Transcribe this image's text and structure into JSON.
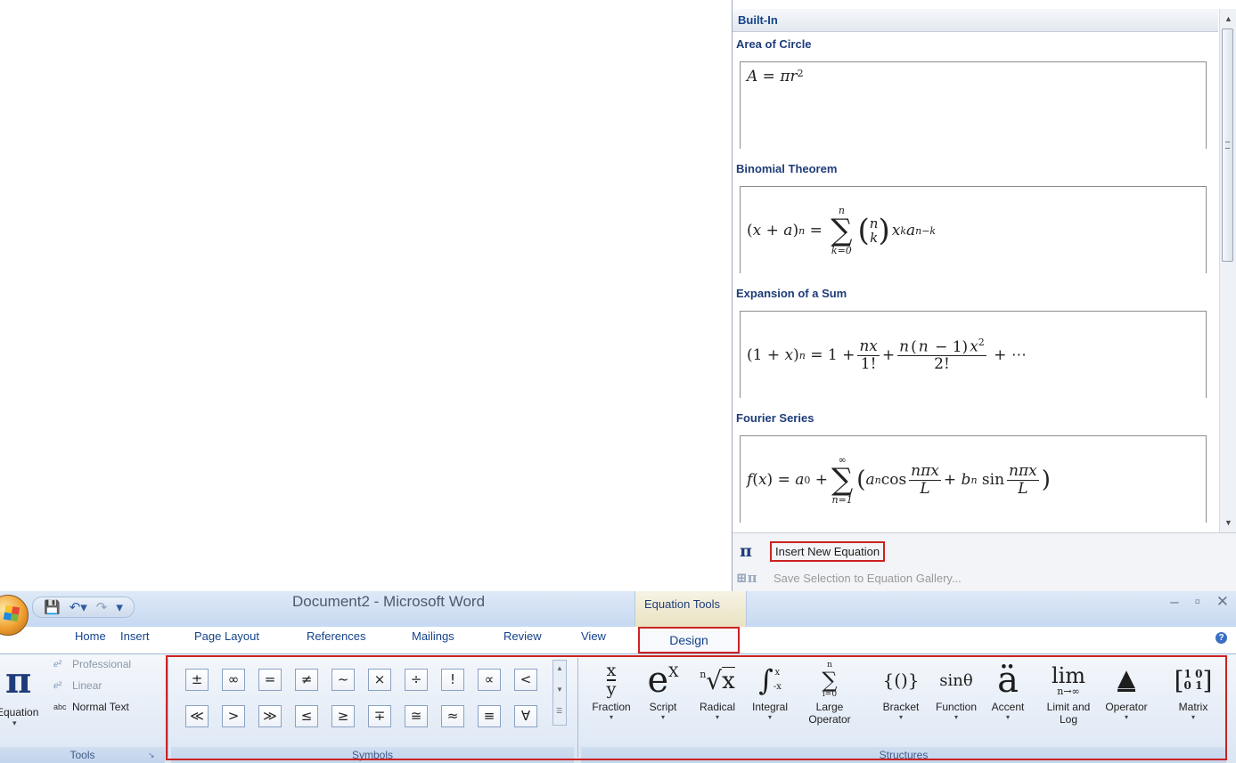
{
  "gallery": {
    "category": "Built-In",
    "equations": [
      {
        "title": "Area of Circle"
      },
      {
        "title": "Binomial Theorem"
      },
      {
        "title": "Expansion of a Sum"
      },
      {
        "title": "Fourier Series"
      }
    ],
    "commands": [
      {
        "label": "Insert New Equation",
        "icon": "pi-icon",
        "enabled": true
      },
      {
        "label": "Save Selection to Equation Gallery...",
        "icon": "save-equation-icon",
        "enabled": false
      }
    ]
  },
  "titlebar": {
    "document_title": "Document2 - Microsoft Word",
    "context_tab_group": "Equation Tools"
  },
  "tabs": [
    "Home",
    "Insert",
    "Page Layout",
    "References",
    "Mailings",
    "Review",
    "View",
    "Design"
  ],
  "active_tab": "Design",
  "groups": {
    "tools": {
      "label": "Tools",
      "equation_button": "Equation",
      "options": [
        "Professional",
        "Linear",
        "Normal Text"
      ]
    },
    "symbols": {
      "label": "Symbols",
      "row1": [
        "±",
        "∞",
        "=",
        "≠",
        "~",
        "×",
        "÷",
        "!",
        "∝",
        "<"
      ],
      "row2": [
        "≪",
        ">",
        "≫",
        "≤",
        "≥",
        "∓",
        "≅",
        "≈",
        "≡",
        "∀"
      ]
    },
    "structures": {
      "label": "Structures",
      "items": [
        {
          "label": "Fraction",
          "icon": "fraction-icon"
        },
        {
          "label": "Script",
          "icon": "script-icon"
        },
        {
          "label": "Radical",
          "icon": "radical-icon"
        },
        {
          "label": "Integral",
          "icon": "integral-icon"
        },
        {
          "label": "Large Operator",
          "icon": "large-operator-icon"
        },
        {
          "label": "Bracket",
          "icon": "bracket-icon"
        },
        {
          "label": "Function",
          "icon": "function-icon"
        },
        {
          "label": "Accent",
          "icon": "accent-icon"
        },
        {
          "label": "Limit and Log",
          "icon": "limit-icon"
        },
        {
          "label": "Operator",
          "icon": "operator-icon"
        },
        {
          "label": "Matrix",
          "icon": "matrix-icon"
        }
      ]
    }
  },
  "colors": {
    "highlight_border": "#cc2222",
    "heading_blue": "#1e3c7a",
    "ribbon_bg": "#dbe6f4"
  }
}
